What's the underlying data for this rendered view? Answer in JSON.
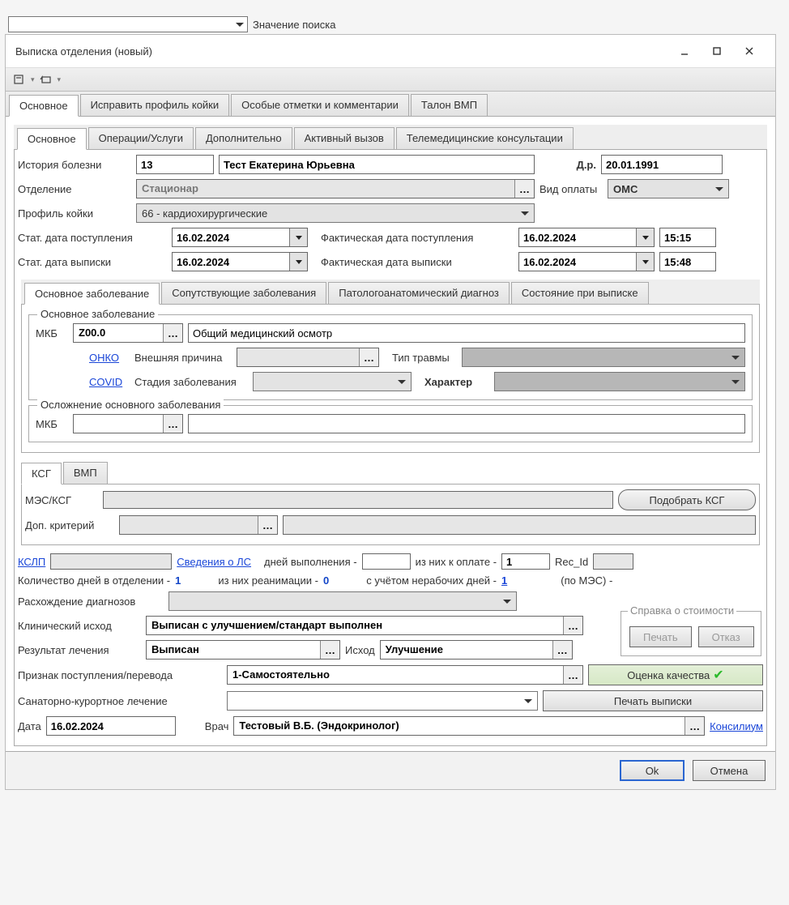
{
  "topbar": {
    "search_label": "Значение поиска",
    "search_value": ""
  },
  "window": {
    "title": "Выписка отделения (новый)"
  },
  "main_tabs": [
    "Основное",
    "Исправить профиль койки",
    "Особые отметки и комментарии",
    "Талон ВМП"
  ],
  "sub_tabs": [
    "Основное",
    "Операции/Услуги",
    "Дополнительно",
    "Активный вызов",
    "Телемедицинские консультации"
  ],
  "patient": {
    "history_label": "История болезни",
    "history_value": "13",
    "name_value": "Тест Екатерина Юрьевна",
    "dob_label": "Д.р.",
    "dob_value": "20.01.1991",
    "dept_label": "Отделение",
    "dept_value": "Стационар",
    "payment_label": "Вид оплаты",
    "payment_value": "ОМС",
    "bed_profile_label": "Профиль койки",
    "bed_profile_value": "66 - кардиохирургические",
    "stat_admit_label": "Стат. дата поступления",
    "stat_admit_value": "16.02.2024",
    "actual_admit_label": "Фактическая дата поступления",
    "actual_admit_value": "16.02.2024",
    "actual_admit_time": "15:15",
    "stat_discharge_label": "Стат. дата выписки",
    "stat_discharge_value": "16.02.2024",
    "actual_discharge_label": "Фактическая дата выписки",
    "actual_discharge_value": "16.02.2024",
    "actual_discharge_time": "15:48"
  },
  "diag_tabs": [
    "Основное заболевание",
    "Сопутствующие заболевания",
    "Патологоанатомический диагноз",
    "Состояние при выписке"
  ],
  "main_diag": {
    "legend": "Основное заболевание",
    "mkb_label": "МКБ",
    "mkb_code": "Z00.0",
    "mkb_name": "Общий медицинский осмотр",
    "onko_link": "ОНКО",
    "ext_cause_label": "Внешняя причина",
    "trauma_type_label": "Тип травмы",
    "covid_link": "COVID",
    "stage_label": "Стадия заболевания",
    "character_label": "Характер"
  },
  "complication": {
    "legend": "Осложнение основного заболевания",
    "mkb_label": "МКБ"
  },
  "ksg_tabs": [
    "КСГ",
    "ВМП"
  ],
  "ksg": {
    "mes_label": "МЭС/КСГ",
    "pick_btn": "Подобрать КСГ",
    "extra_label": "Доп. критерий",
    "kslp_link": "КСЛП",
    "ls_link": "Сведения о ЛС",
    "days_exec_label": "дней выполнения -",
    "days_pay_label": "из них к оплате -",
    "days_pay_value": "1",
    "recid_label": "Rec_Id",
    "days_dept_label": "Количество дней в отделении -",
    "days_dept_value": "1",
    "reanim_label": "из них реанимации -",
    "reanim_value": "0",
    "nowork_label": "с учётом нерабочих дней -",
    "nowork_value": "1",
    "mes_calc_label": "(по МЭС) -"
  },
  "results": {
    "divergence_label": "Расхождение диагнозов",
    "clinical_label": "Клинический исход",
    "clinical_value": "Выписан с улучшением/стандарт выполнен",
    "cost_legend": "Справка о стоимости",
    "print_btn": "Печать",
    "refuse_btn": "Отказ",
    "result_label": "Результат лечения",
    "result_value": "Выписан",
    "outcome_label": "Исход",
    "outcome_value": "Улучшение",
    "admit_sign_label": "Признак поступления/перевода",
    "admit_sign_value": "1-Самостоятельно",
    "quality_btn": "Оценка качества",
    "sanatorium_label": "Санаторно-курортное лечение",
    "print_discharge_btn": "Печать выписки",
    "date_label": "Дата",
    "date_value": "16.02.2024",
    "doctor_label": "Врач",
    "doctor_value": "Тестовый В.Б. (Эндокринолог)",
    "consilium_link": "Консилиум"
  },
  "footer": {
    "ok": "Ok",
    "cancel": "Отмена"
  }
}
